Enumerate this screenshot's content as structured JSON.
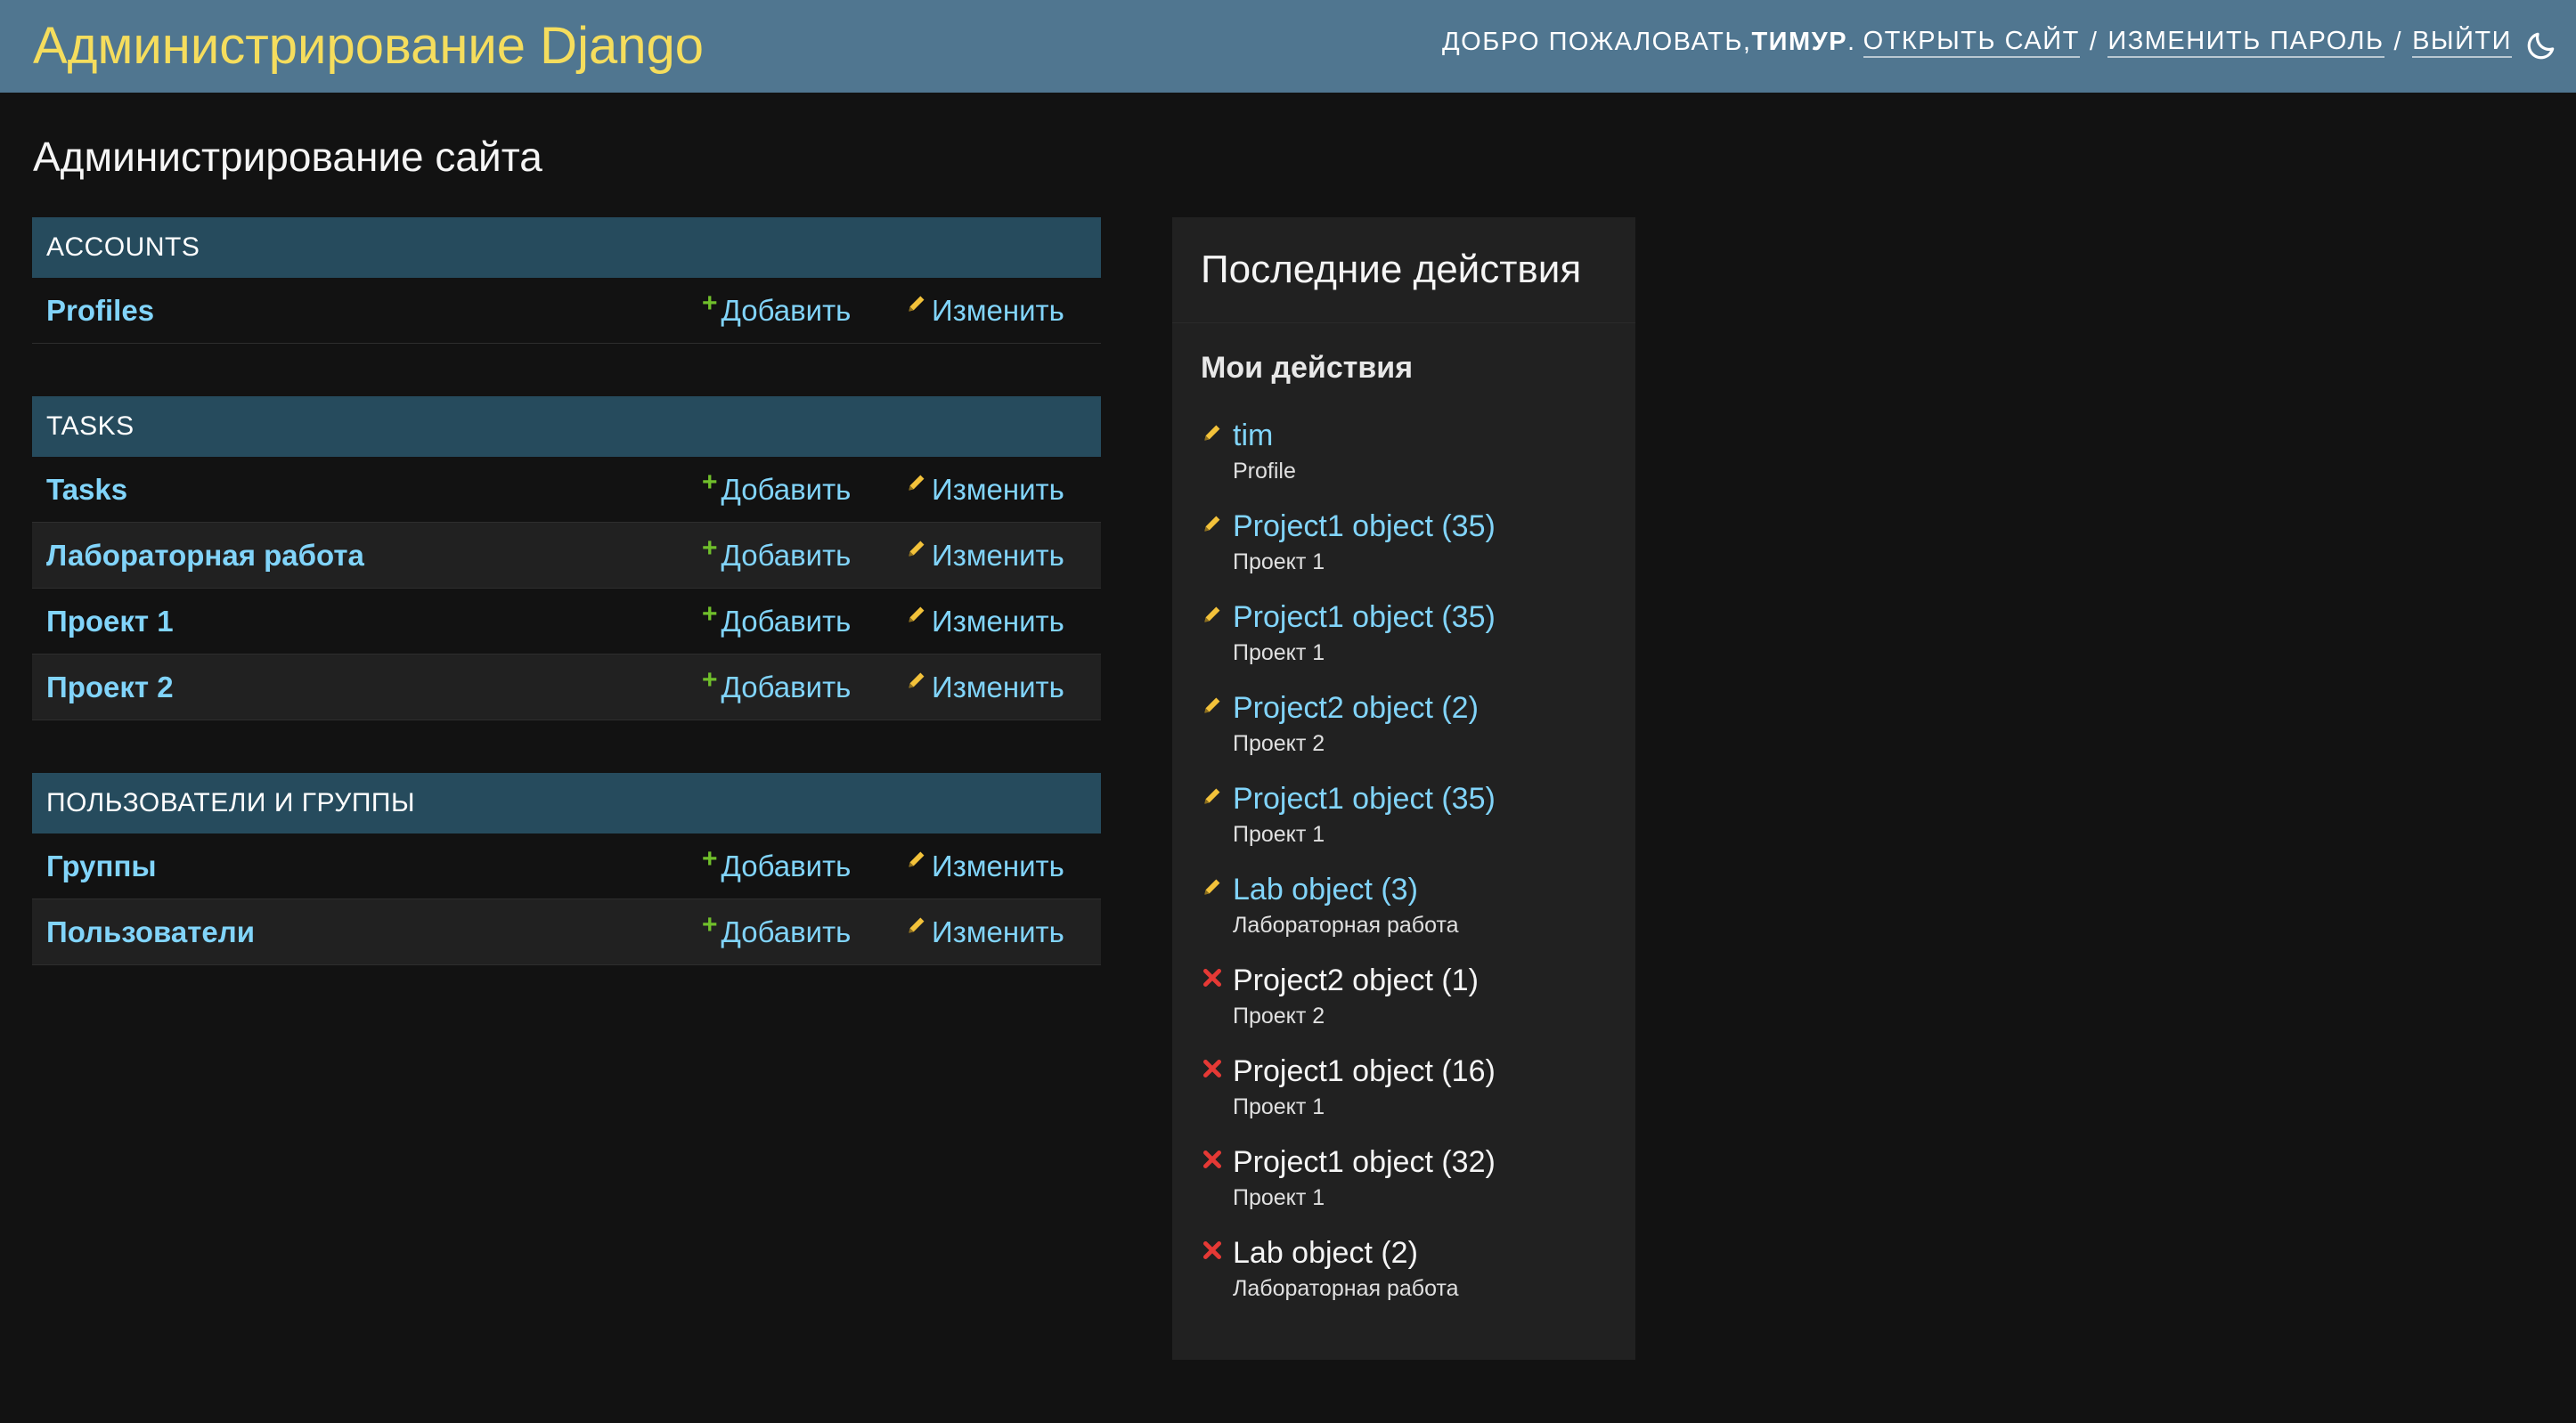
{
  "header": {
    "branding": "Администрирование Django",
    "welcome_prefix": "ДОБРО ПОЖАЛОВАТЬ, ",
    "username": "ТИМУР",
    "welcome_suffix": ".",
    "view_site": "ОТКРЫТЬ САЙТ",
    "change_password": "ИЗМЕНИТЬ ПАРОЛЬ",
    "logout": "ВЫЙТИ",
    "separator": "/",
    "theme_icon": "moon-icon"
  },
  "page_title": "Администрирование сайта",
  "colors": {
    "header_bg": "#507690",
    "branding": "#f5dd5d",
    "module_caption_bg": "#264b5d",
    "link": "#81d4fa",
    "add_icon": "#70bf2b",
    "change_icon": "#f3c23a",
    "delete_icon": "#e53935",
    "page_bg": "#121212",
    "panel_bg": "#212121"
  },
  "labels": {
    "add": "Добавить",
    "change": "Изменить"
  },
  "modules": [
    {
      "caption": "ACCOUNTS",
      "models": [
        {
          "name": "Profiles"
        }
      ]
    },
    {
      "caption": "TASKS",
      "models": [
        {
          "name": "Tasks"
        },
        {
          "name": "Лабораторная работа"
        },
        {
          "name": "Проект 1"
        },
        {
          "name": "Проект 2"
        }
      ]
    },
    {
      "caption": "ПОЛЬЗОВАТЕЛИ И ГРУППЫ",
      "models": [
        {
          "name": "Группы"
        },
        {
          "name": "Пользователи"
        }
      ]
    }
  ],
  "recent_actions": {
    "title": "Последние действия",
    "subtitle": "Мои действия",
    "items": [
      {
        "kind": "change",
        "object": "tim",
        "type": "Profile"
      },
      {
        "kind": "change",
        "object": "Project1 object (35)",
        "type": "Проект 1"
      },
      {
        "kind": "change",
        "object": "Project1 object (35)",
        "type": "Проект 1"
      },
      {
        "kind": "change",
        "object": "Project2 object (2)",
        "type": "Проект 2"
      },
      {
        "kind": "change",
        "object": "Project1 object (35)",
        "type": "Проект 1"
      },
      {
        "kind": "change",
        "object": "Lab object (3)",
        "type": "Лабораторная работа"
      },
      {
        "kind": "delete",
        "object": "Project2 object (1)",
        "type": "Проект 2"
      },
      {
        "kind": "delete",
        "object": "Project1 object (16)",
        "type": "Проект 1"
      },
      {
        "kind": "delete",
        "object": "Project1 object (32)",
        "type": "Проект 1"
      },
      {
        "kind": "delete",
        "object": "Lab object (2)",
        "type": "Лабораторная работа"
      }
    ]
  }
}
